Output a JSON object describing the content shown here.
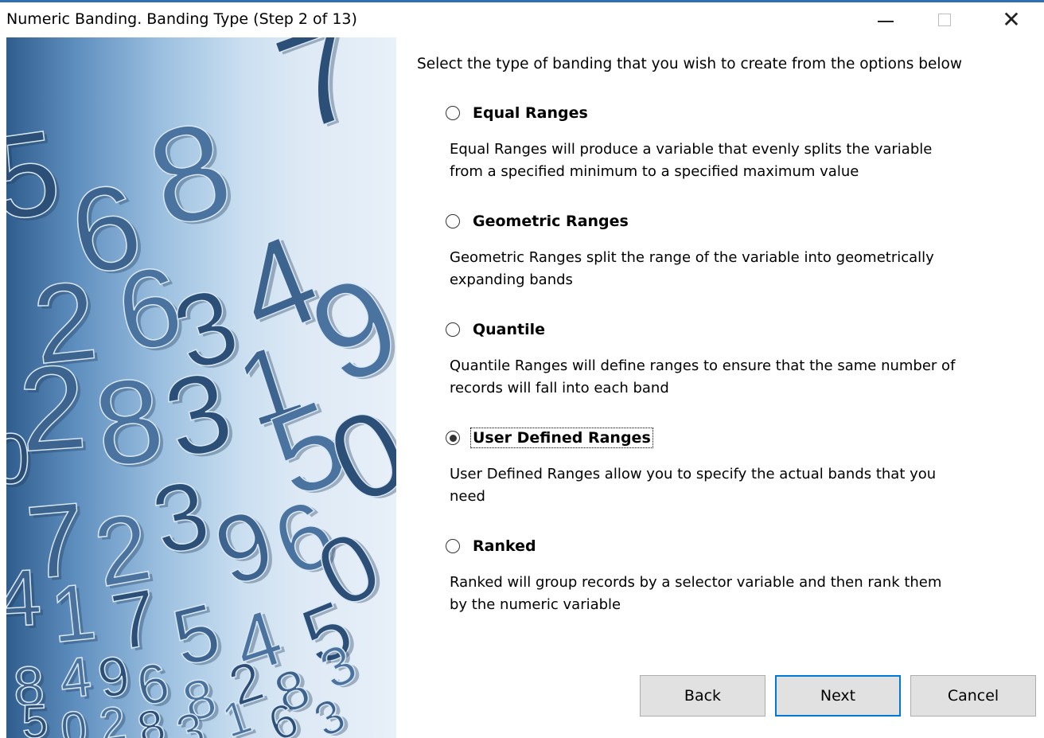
{
  "window": {
    "title": "Numeric Banding.  Banding Type (Step 2 of 13)",
    "accent_color": "#2f6fb2"
  },
  "side_image": {
    "digits": [
      "5",
      "6",
      "8",
      "7",
      "2",
      "6",
      "3",
      "4",
      "9",
      "0",
      "2",
      "8",
      "3",
      "1",
      "5",
      "0",
      "7",
      "2",
      "3",
      "9",
      "6",
      "0",
      "4",
      "1",
      "7",
      "5",
      "4",
      "5",
      "8",
      "4",
      "9",
      "6",
      "8",
      "2",
      "8",
      "3",
      "5",
      "0",
      "2",
      "8",
      "3",
      "1",
      "6",
      "3"
    ]
  },
  "instruction": "Select the type of banding that you wish to create from the options below",
  "options": [
    {
      "label": "Equal Ranges",
      "selected": false,
      "description": "Equal Ranges will produce a variable that evenly splits the variable from a specified minimum to a specified maximum value"
    },
    {
      "label": "Geometric Ranges",
      "selected": false,
      "description": "Geometric Ranges split the range of the variable into geometrically expanding bands"
    },
    {
      "label": "Quantile",
      "selected": false,
      "description": "Quantile Ranges will define ranges to ensure that the same number of records will fall into each band"
    },
    {
      "label": "User Defined Ranges",
      "selected": true,
      "description": "User Defined Ranges allow you to specify the actual bands that you need"
    },
    {
      "label": "Ranked",
      "selected": false,
      "description": "Ranked will group records by a selector variable and then rank them by the numeric variable"
    }
  ],
  "buttons": {
    "back": "Back",
    "next": "Next",
    "cancel": "Cancel"
  },
  "icons": {
    "minimize": "minimize-icon",
    "maximize": "maximize-icon",
    "close": "close-icon",
    "close_glyph": "✕"
  }
}
